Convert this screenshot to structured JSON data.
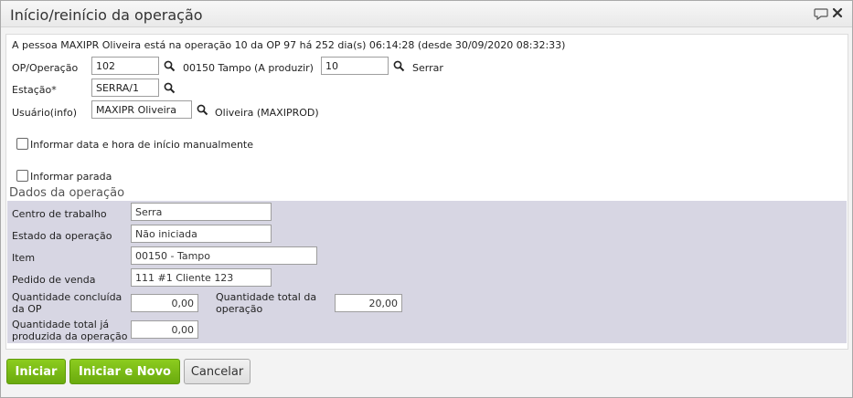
{
  "dialog": {
    "title": "Início/reinício da operação"
  },
  "info_text": "A pessoa MAXIPR Oliveira está na operação 10 da OP 97 há 252 dia(s) 06:14:28 (desde 30/09/2020 08:32:33)",
  "form": {
    "op_label": "OP/Operação",
    "op_value": "102",
    "op_description": "00150 Tampo (A produzir)",
    "operation_value": "10",
    "operation_description": "Serrar",
    "station_label": "Estação*",
    "station_value": "SERRA/1",
    "user_label": "Usuário(info)",
    "user_value": "MAXIPR Oliveira",
    "user_description": "Oliveira (MAXIPROD)",
    "manual_datetime_label": "Informar data e hora de início manualmente",
    "inform_stop_label": "Informar parada"
  },
  "operation_data": {
    "section_title": "Dados da operação",
    "work_center_label": "Centro de trabalho",
    "work_center_value": "Serra",
    "state_label": "Estado da operação",
    "state_value": "Não iniciada",
    "item_label": "Item",
    "item_value": "00150 - Tampo",
    "sales_order_label": "Pedido de venda",
    "sales_order_value": "111 #1 Cliente 123",
    "qty_done_op_label_1": "Quantidade concluída",
    "qty_done_op_label_2": "da OP",
    "qty_done_op_value": "0,00",
    "qty_total_op_label_1": "Quantidade total da",
    "qty_total_op_label_2": "operação",
    "qty_total_op_value": "20,00",
    "qty_produced_label_1": "Quantidade total já",
    "qty_produced_label_2": "produzida da operação",
    "qty_produced_value": "0,00"
  },
  "buttons": {
    "start": "Iniciar",
    "start_new": "Iniciar e Novo",
    "cancel": "Cancelar"
  },
  "icons": {
    "search": "search-icon",
    "chat": "chat-icon",
    "close": "close-icon"
  }
}
